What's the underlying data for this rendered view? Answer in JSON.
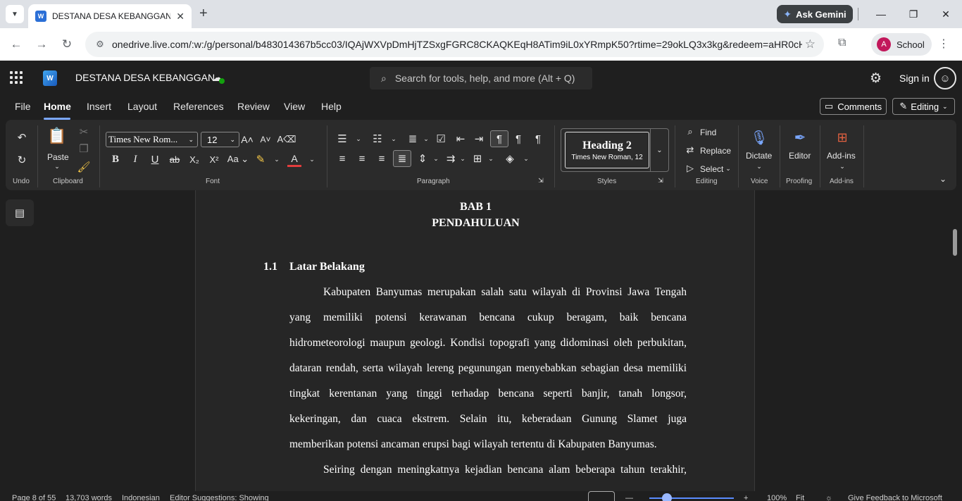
{
  "browser": {
    "tab_title": "DESTANA DESA KEBANGGAN.d",
    "tab_favicon": "W",
    "ask_gemini": "Ask Gemini",
    "url": "onedrive.live.com/:w:/g/personal/b483014367b5cc03/IQAjWXVpDmHjTZSxgFGRC8CKAQKEqH8ATim9iL0xYRmpK50?rtime=29okLQ3x3kg&redeem=aHR0cH...",
    "profile_initial": "A",
    "profile_label": "School"
  },
  "app": {
    "logo_letter": "W",
    "doc_title": "DESTANA DESA KEBANGGAN",
    "search_placeholder": "Search for tools, help, and more (Alt + Q)",
    "sign_in": "Sign in"
  },
  "menu": {
    "items": [
      "File",
      "Home",
      "Insert",
      "Layout",
      "References",
      "Review",
      "View",
      "Help"
    ],
    "active": "Home",
    "comments": "Comments",
    "editing": "Editing"
  },
  "ribbon": {
    "groups": {
      "undo": "Undo",
      "clipboard": "Clipboard",
      "font": "Font",
      "paragraph": "Paragraph",
      "styles": "Styles",
      "editing": "Editing",
      "voice": "Voice",
      "proofing": "Proofing",
      "addins": "Add-ins"
    },
    "paste": "Paste",
    "font_name": "Times New Rom...",
    "font_size": "12",
    "style_name": "Heading 2",
    "style_desc": "Times New Roman, 12",
    "find": "Find",
    "replace": "Replace",
    "select": "Select",
    "dictate": "Dictate",
    "editor": "Editor",
    "addins": "Add-ins"
  },
  "document": {
    "chapter": "BAB 1",
    "chapter_title": "PENDAHULUAN",
    "section_number": "1.1",
    "section_title": "Latar Belakang",
    "lines": [
      "Kabupaten Banyumas merupakan salah satu wilayah di Provinsi Jawa Tengah",
      "yang memiliki potensi kerawanan bencana cukup beragam, baik bencana",
      "hidrometeorologi maupun geologi. Kondisi topografi yang didominasi oleh perbukitan,",
      "dataran rendah, serta wilayah lereng pegunungan menyebabkan sebagian desa memiliki",
      "tingkat kerentanan yang tinggi terhadap bencana seperti banjir, tanah longsor,",
      "kekeringan, dan cuaca ekstrem. Selain itu, keberadaan Gunung Slamet juga",
      "memberikan potensi ancaman erupsi bagi wilayah tertentu di Kabupaten Banyumas.",
      "Seiring dengan meningkatnya kejadian bencana alam beberapa tahun terakhir,"
    ]
  },
  "status": {
    "page": "Page 8 of 55",
    "words": "13,703 words",
    "language": "Indonesian",
    "suggestions": "Editor Suggestions: Showing",
    "zoom": "100%",
    "fit": "Fit",
    "feedback": "Give Feedback to Microsoft"
  },
  "colors": {
    "accent": "#7aa7ff",
    "word_blue": "#185abd",
    "dark_bg": "#1f1f1f",
    "ribbon_bg": "#2b2b2b",
    "highlight_yellow": "#f7c948",
    "font_red": "#e23d3d"
  }
}
